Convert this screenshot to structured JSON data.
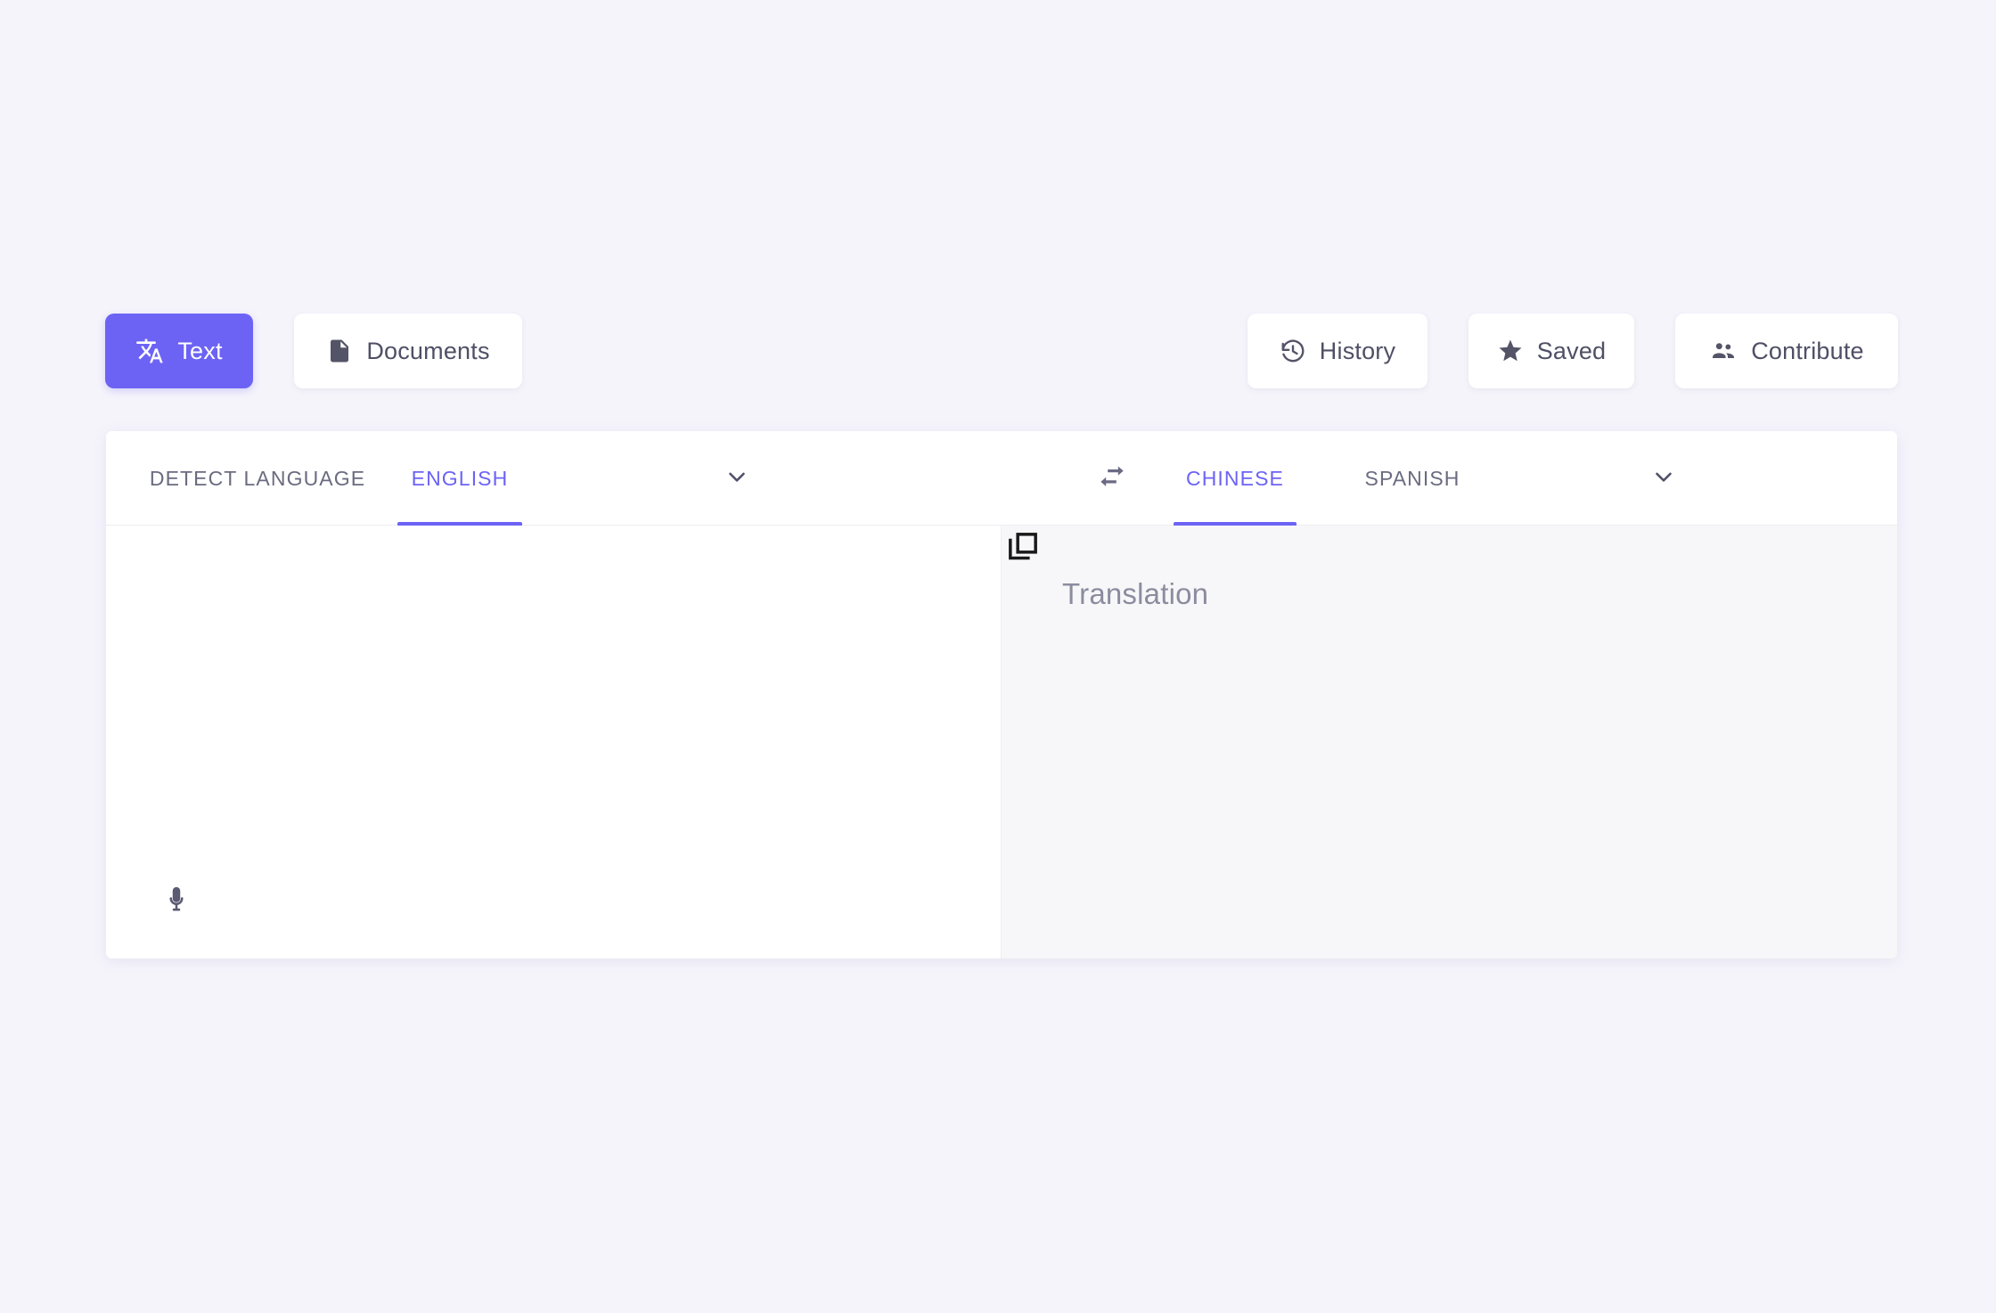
{
  "theme": {
    "page_background": "#f5f4fb",
    "accent": "#6c63f5",
    "card_background": "#ffffff",
    "target_pane_background": "#f7f7f9",
    "muted_text": "#6b6b80",
    "body_text": "#4f4f66",
    "placeholder_text": "#8c8ca0"
  },
  "toolbar": {
    "left_buttons": [
      {
        "label": "Text",
        "icon": "translate-icon",
        "active": true
      },
      {
        "label": "Documents",
        "icon": "document-icon",
        "active": false
      }
    ],
    "right_buttons": [
      {
        "label": "History",
        "icon": "history-icon"
      },
      {
        "label": "Saved",
        "icon": "star-icon"
      },
      {
        "label": "Contribute",
        "icon": "people-icon"
      }
    ]
  },
  "translator": {
    "source": {
      "tabs": [
        {
          "label": "DETECT LANGUAGE",
          "active": false
        },
        {
          "label": "ENGLISH",
          "active": true
        }
      ],
      "dropdown_icon": "chevron-down-icon",
      "text_value": "",
      "placeholder": "",
      "mic_icon": "microphone-icon"
    },
    "swap": {
      "icon": "swap-horizontal-icon"
    },
    "target": {
      "tabs": [
        {
          "label": "CHINESE",
          "active": true
        },
        {
          "label": "SPANISH",
          "active": false
        }
      ],
      "dropdown_icon": "chevron-down-icon",
      "placeholder": "Translation",
      "copy_icon": "copy-icon"
    }
  }
}
